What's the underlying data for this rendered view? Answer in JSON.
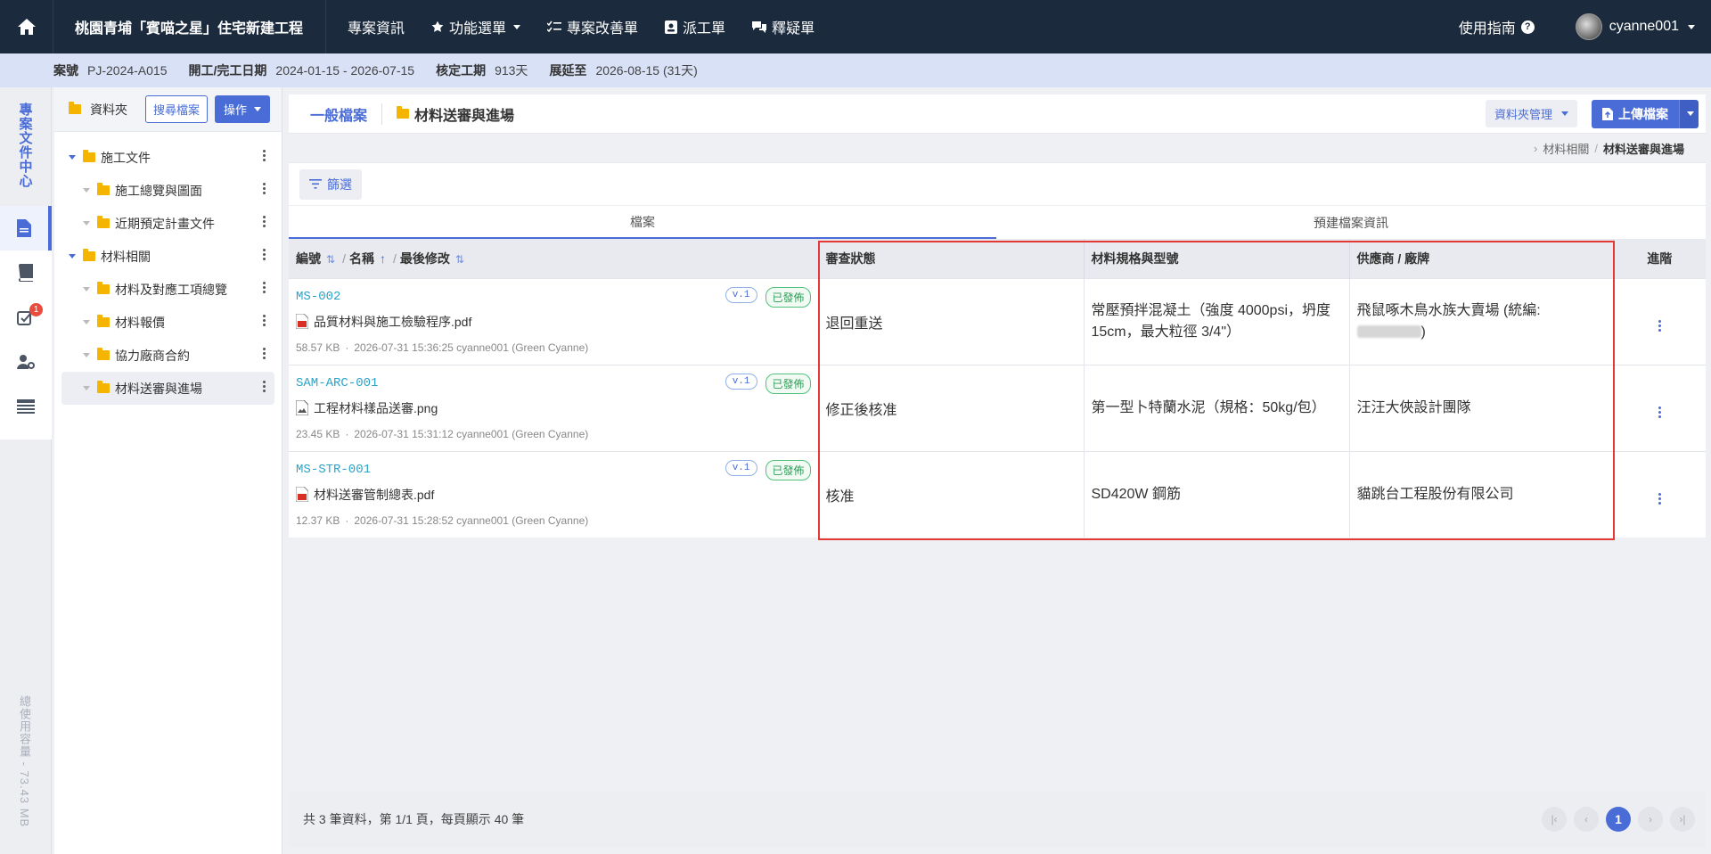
{
  "topbar": {
    "project_name": "桃園青埔「賓喵之星」住宅新建工程",
    "nav": [
      {
        "label": "專案資訊"
      },
      {
        "label": "功能選單"
      },
      {
        "label": "專案改善單"
      },
      {
        "label": "派工單"
      },
      {
        "label": "釋疑單"
      }
    ],
    "guide": "使用指南",
    "help_glyph": "?",
    "username": "cyanne001"
  },
  "infobar": {
    "case_label": "案號",
    "case_value": "PJ-2024-A015",
    "dates_label": "開工/完工日期",
    "dates_value": "2024-01-15 - 2026-07-15",
    "period_label": "核定工期",
    "period_value": "913天",
    "extend_label": "展延至",
    "extend_value": "2026-08-15 (31天)"
  },
  "rail": {
    "title": "專案文件中心",
    "badge": "1",
    "usage": "總使用容量 - 73.43 MB"
  },
  "folders": {
    "header_label": "資料夾",
    "search_button": "搜尋檔案",
    "action_button": "操作",
    "tree": [
      {
        "label": "施工文件",
        "level": 0
      },
      {
        "label": "施工總覽與圖面",
        "level": 1
      },
      {
        "label": "近期預定計畫文件",
        "level": 1
      },
      {
        "label": "材料相關",
        "level": 0
      },
      {
        "label": "材料及對應工項總覽",
        "level": 1
      },
      {
        "label": "材料報價",
        "level": 1
      },
      {
        "label": "協力廠商合約",
        "level": 1
      },
      {
        "label": "材料送審與進場",
        "level": 1,
        "selected": true
      }
    ]
  },
  "main": {
    "crumb_root": "一般檔案",
    "crumb_current": "材料送審與進場",
    "folder_manage": "資料夾管理",
    "upload": "上傳檔案",
    "sub_crumb_parent": "材料相關",
    "sub_crumb_sep": "/",
    "sub_crumb_current": "材料送審與進場",
    "filter": "篩選",
    "tabs": [
      "檔案",
      "預建檔案資訊"
    ],
    "headers": {
      "code": "編號",
      "name": "名稱",
      "modified": "最後修改",
      "sep": "/",
      "review": "審查狀態",
      "spec": "材料規格與型號",
      "supplier": "供應商 / 廠牌",
      "advanced": "進階"
    },
    "rows": [
      {
        "code": "MS-002",
        "version": "v.1",
        "status": "已發佈",
        "file_name": "品質材料與施工檢驗程序.pdf",
        "file_type": "pdf",
        "size": "58.57 KB",
        "dot": "·",
        "modified": "2026-07-31 15:36:25",
        "user": "cyanne001 (Green Cyanne)",
        "review": "退回重送",
        "spec": "常壓預拌混凝土（強度 4000psi，坍度 15cm，最大粒徑 3/4\"）",
        "supplier_prefix": "飛鼠啄木鳥水族大賣場 (統編:",
        "supplier_suffix": ")"
      },
      {
        "code": "SAM-ARC-001",
        "version": "v.1",
        "status": "已發佈",
        "file_name": "工程材料樣品送審.png",
        "file_type": "image",
        "size": "23.45 KB",
        "dot": "·",
        "modified": "2026-07-31 15:31:12",
        "user": "cyanne001 (Green Cyanne)",
        "review": "修正後核准",
        "spec": "第一型卜特蘭水泥（規格：50kg/包）",
        "supplier_prefix": "汪汪大俠設計團隊",
        "supplier_suffix": ""
      },
      {
        "code": "MS-STR-001",
        "version": "v.1",
        "status": "已發佈",
        "file_name": "材料送審管制總表.pdf",
        "file_type": "pdf",
        "size": "12.37 KB",
        "dot": "·",
        "modified": "2026-07-31 15:28:52",
        "user": "cyanne001 (Green Cyanne)",
        "review": "核准",
        "spec": "SD420W 鋼筋",
        "supplier_prefix": "貓跳台工程股份有限公司",
        "supplier_suffix": ""
      }
    ]
  },
  "footer": {
    "summary": "共 3 筆資料，第 1/1 頁，每頁顯示 40 筆",
    "current_page": "1"
  },
  "colors": {
    "topbar": "#1b2a3d",
    "accent": "#4a6cd6",
    "infobar": "#d9e1f7",
    "published_green": "#2e9e57",
    "highlight_red": "#e53935"
  }
}
